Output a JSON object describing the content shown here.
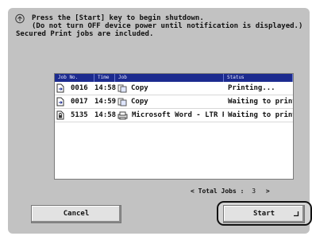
{
  "message": {
    "line1": "Press the [Start] key to begin shutdown.",
    "line2": "(Do not turn OFF device power until notification is displayed.)",
    "line3": "Secured Print jobs are included."
  },
  "table": {
    "headers": {
      "job_no": "Job No.",
      "time": "Time",
      "job": "Job",
      "status": "Status"
    },
    "rows": [
      {
        "job_no": "0016",
        "time": "14:58",
        "job": "Copy",
        "status": "Printing...",
        "icon": "copy-job-icon",
        "num_icon": "document-arrow-icon"
      },
      {
        "job_no": "0017",
        "time": "14:59",
        "job": "Copy",
        "status": "Waiting to print..",
        "icon": "copy-job-icon",
        "num_icon": "document-arrow-icon"
      },
      {
        "job_no": "5135",
        "time": "14:58",
        "job": "Microsoft Word - LTR P",
        "status": "Waiting to print..",
        "icon": "pc-print-job-icon",
        "num_icon": "secured-document-icon"
      }
    ]
  },
  "total": {
    "prefix": "< Total Jobs :",
    "count": "3",
    "suffix": ">"
  },
  "buttons": {
    "cancel": "Cancel",
    "start": "Start"
  },
  "colors": {
    "header_bg": "#1c2b8f",
    "screen_bg": "#c2c2c2"
  }
}
